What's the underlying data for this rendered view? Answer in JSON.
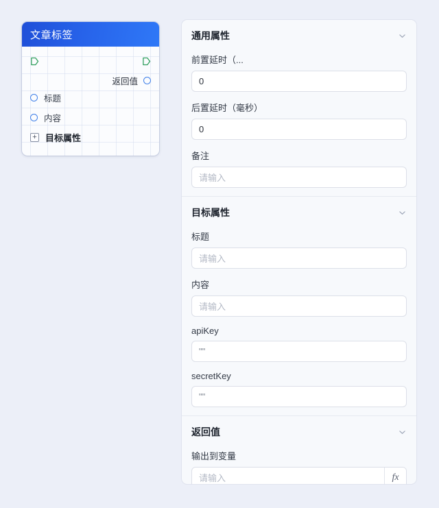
{
  "canvas": {
    "background_color": "#eceff8"
  },
  "node": {
    "title": "文章标签",
    "header_gradient_from": "#1f4fd8",
    "header_gradient_to": "#2f78f7",
    "flow_port_color": "#2f9e5c",
    "data_port_color": "#3f7fe8",
    "ports": {
      "flow_in": "flow-in-port",
      "flow_out": "flow-out-port",
      "return_label": "返回值"
    },
    "inputs": [
      {
        "label": "标题"
      },
      {
        "label": "内容"
      }
    ],
    "group": {
      "label": "目标属性",
      "expand_symbol": "+"
    }
  },
  "panel": {
    "sections": [
      {
        "title": "通用属性",
        "collapse_icon": "chevron-down-icon",
        "fields": [
          {
            "label": "前置延时（...",
            "value": "0",
            "placeholder": ""
          },
          {
            "label": "后置延时（毫秒）",
            "value": "0",
            "placeholder": ""
          },
          {
            "label": "备注",
            "value": "",
            "placeholder": "请输入"
          }
        ]
      },
      {
        "title": "目标属性",
        "collapse_icon": "chevron-down-icon",
        "fields": [
          {
            "label": "标题",
            "value": "",
            "placeholder": "请输入"
          },
          {
            "label": "内容",
            "value": "",
            "placeholder": "请输入"
          },
          {
            "label": "apiKey",
            "value": "\"\"",
            "placeholder": ""
          },
          {
            "label": "secretKey",
            "value": "\"\"",
            "placeholder": ""
          }
        ]
      },
      {
        "title": "返回值",
        "collapse_icon": "chevron-down-icon",
        "fields": [
          {
            "label": "输出到变量",
            "value": "",
            "placeholder": "请输入",
            "suffix_button": "fx"
          }
        ]
      }
    ]
  }
}
